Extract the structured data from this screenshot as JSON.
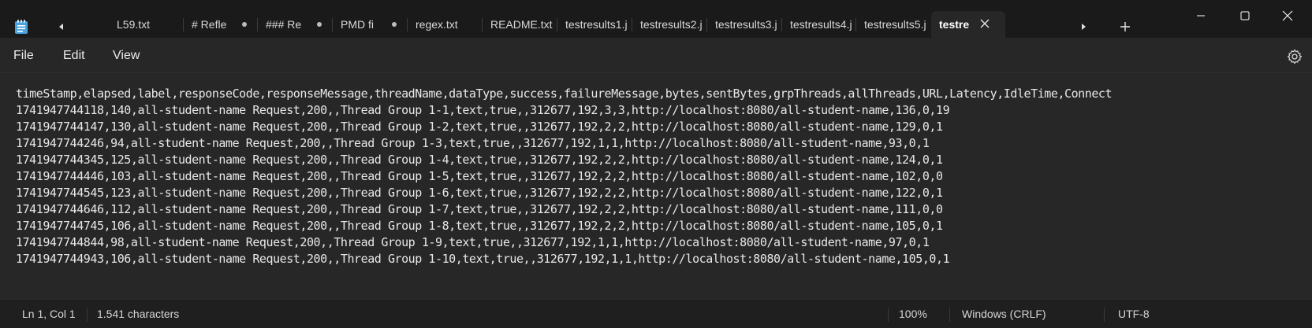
{
  "tabs": [
    {
      "label": "L59.txt",
      "dot": false
    },
    {
      "label": "# Refle",
      "dot": true
    },
    {
      "label": "### Re",
      "dot": true
    },
    {
      "label": "PMD fi",
      "dot": true
    },
    {
      "label": "regex.txt",
      "dot": false
    },
    {
      "label": "README.txt",
      "dot": false
    },
    {
      "label": "testresults1.j",
      "dot": false
    },
    {
      "label": "testresults2.j",
      "dot": false
    },
    {
      "label": "testresults3.j",
      "dot": false
    },
    {
      "label": "testresults4.j",
      "dot": false
    },
    {
      "label": "testresults5.j",
      "dot": false
    }
  ],
  "active_tab": {
    "label": "testre"
  },
  "menu": {
    "file": "File",
    "edit": "Edit",
    "view": "View"
  },
  "editor": {
    "lines": [
      "timeStamp,elapsed,label,responseCode,responseMessage,threadName,dataType,success,failureMessage,bytes,sentBytes,grpThreads,allThreads,URL,Latency,IdleTime,Connect",
      "1741947744118,140,all-student-name Request,200,,Thread Group 1-1,text,true,,312677,192,3,3,http://localhost:8080/all-student-name,136,0,19",
      "1741947744147,130,all-student-name Request,200,,Thread Group 1-2,text,true,,312677,192,2,2,http://localhost:8080/all-student-name,129,0,1",
      "1741947744246,94,all-student-name Request,200,,Thread Group 1-3,text,true,,312677,192,1,1,http://localhost:8080/all-student-name,93,0,1",
      "1741947744345,125,all-student-name Request,200,,Thread Group 1-4,text,true,,312677,192,2,2,http://localhost:8080/all-student-name,124,0,1",
      "1741947744446,103,all-student-name Request,200,,Thread Group 1-5,text,true,,312677,192,2,2,http://localhost:8080/all-student-name,102,0,0",
      "1741947744545,123,all-student-name Request,200,,Thread Group 1-6,text,true,,312677,192,2,2,http://localhost:8080/all-student-name,122,0,1",
      "1741947744646,112,all-student-name Request,200,,Thread Group 1-7,text,true,,312677,192,2,2,http://localhost:8080/all-student-name,111,0,0",
      "1741947744745,106,all-student-name Request,200,,Thread Group 1-8,text,true,,312677,192,2,2,http://localhost:8080/all-student-name,105,0,1",
      "1741947744844,98,all-student-name Request,200,,Thread Group 1-9,text,true,,312677,192,1,1,http://localhost:8080/all-student-name,97,0,1",
      "1741947744943,106,all-student-name Request,200,,Thread Group 1-10,text,true,,312677,192,1,1,http://localhost:8080/all-student-name,105,0,1"
    ]
  },
  "status": {
    "position": "Ln 1, Col 1",
    "characters": "1.541 characters",
    "zoom": "100%",
    "line_ending": "Windows (CRLF)",
    "encoding": "UTF-8"
  },
  "icons": {
    "app": "notepad-icon",
    "scroll_left": "chevron-left-icon",
    "scroll_right": "chevron-right-icon",
    "new_tab": "plus-icon",
    "close_tab": "close-icon",
    "settings": "gear-icon",
    "minimize": "minimize-icon",
    "maximize": "maximize-icon",
    "close_window": "close-icon"
  },
  "colors": {
    "accent": "#4aa3df",
    "background": "#272727",
    "titlebar": "#1a1a1a"
  }
}
